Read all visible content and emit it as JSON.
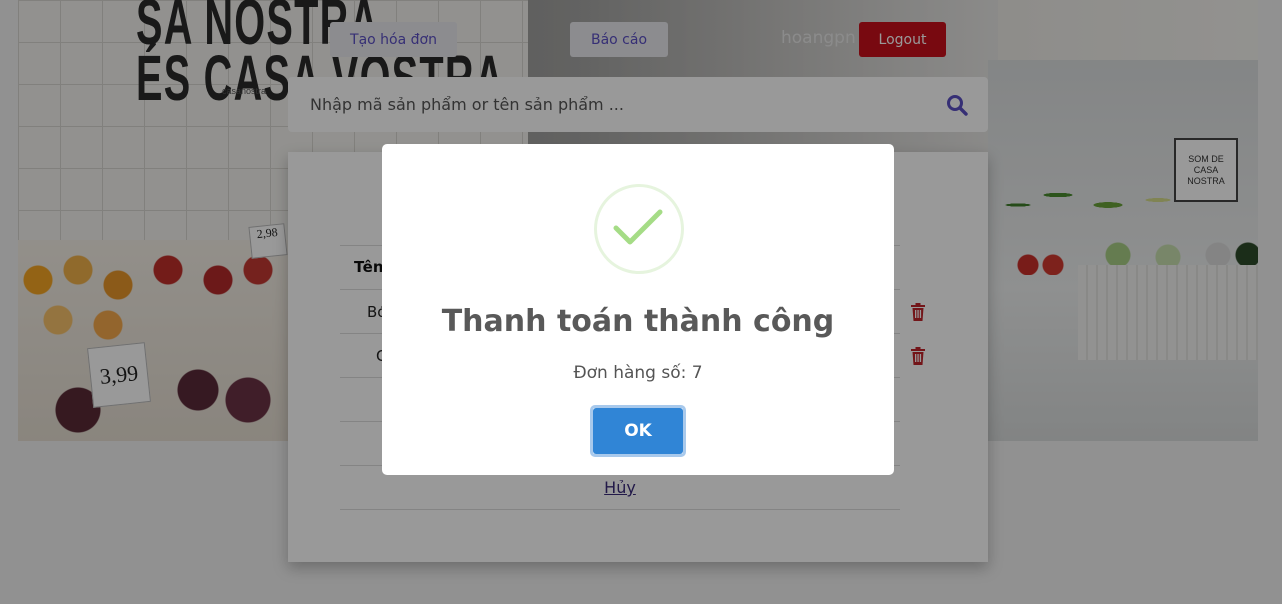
{
  "background": {
    "wall_text_line1": "SA NOSTRA",
    "wall_text_line2": "ÉS CASA VOSTRA",
    "wall_small": "casanostra",
    "price_tag_1": "2,98",
    "price_tag_2": "3,99",
    "sign_board": "SOM DE CASA NOSTRA"
  },
  "header": {
    "create_invoice": "Tạo hóa đơn",
    "report": "Báo cáo",
    "username": "hoangpn",
    "logout": "Logout"
  },
  "search": {
    "placeholder": "Nhập mã sản phẩm or tên sản phẩm ..."
  },
  "invoice": {
    "column_name": "Tên",
    "rows": [
      {
        "name_partial": "Bó"
      },
      {
        "name_partial": "C"
      }
    ],
    "cancel": "Hủy"
  },
  "modal": {
    "title": "Thanh toán thành công",
    "text": "Đơn hàng số: 7",
    "ok": "OK"
  },
  "colors": {
    "logout_bg": "#c9101b",
    "nav_text": "#5b4fc4",
    "ok_bg": "#3085d6",
    "check_green": "#a5dc86",
    "trash_red": "#c0242a"
  }
}
